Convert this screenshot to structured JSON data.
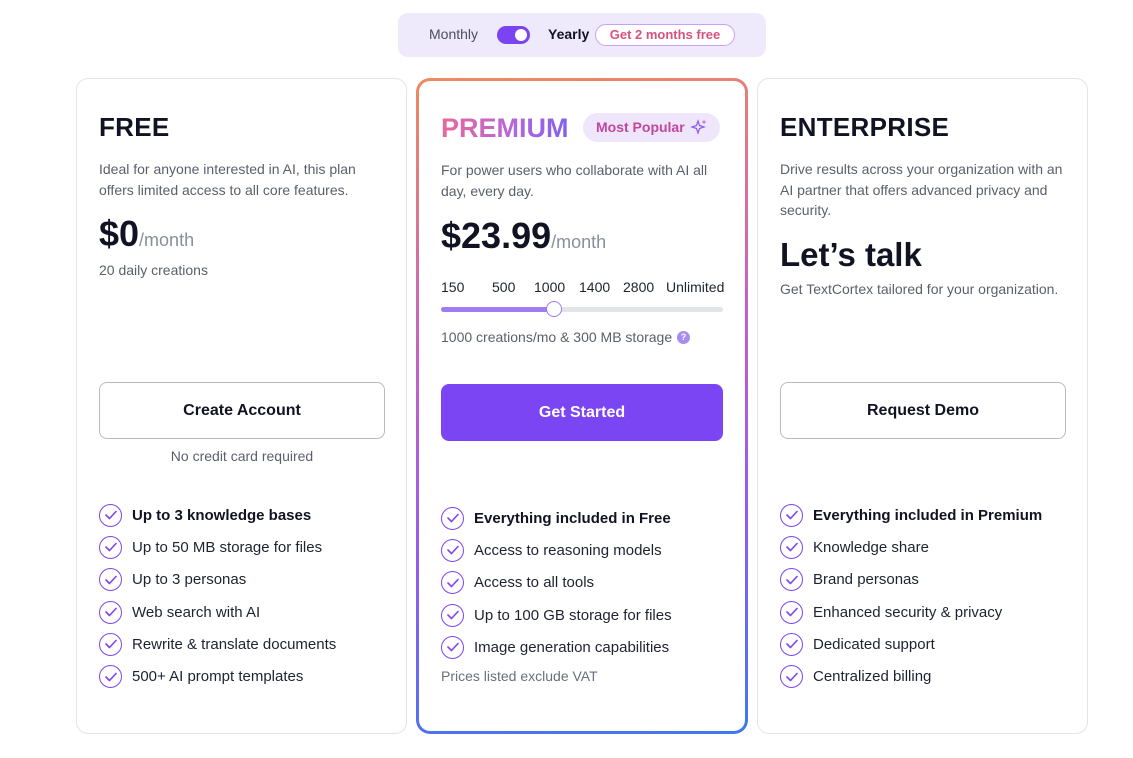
{
  "billing": {
    "monthly_label": "Monthly",
    "yearly_label": "Yearly",
    "promo_label": "Get 2 months free",
    "yearly_selected": true
  },
  "plans": {
    "free": {
      "name": "FREE",
      "description": "Ideal for anyone interested in AI, this plan offers limited access to all core features.",
      "price": "$0",
      "period": "/month",
      "quota": "20 daily creations",
      "cta": "Create Account",
      "cta_note": "No credit card required",
      "features": [
        {
          "text": "Up to 3 knowledge bases",
          "bold": true
        },
        {
          "text": "Up to 50 MB storage for files",
          "bold": false
        },
        {
          "text": "Up to 3 personas",
          "bold": false
        },
        {
          "text": "Web search with AI",
          "bold": false
        },
        {
          "text": "Rewrite & translate documents",
          "bold": false
        },
        {
          "text": "500+ AI prompt templates",
          "bold": false
        }
      ]
    },
    "premium": {
      "name": "PREMIUM",
      "badge": "Most Popular",
      "description": "For power users who collaborate with AI all day, every day.",
      "price": "$23.99",
      "period": "/month",
      "tiers": [
        "150",
        "500",
        "1000",
        "1400",
        "2800",
        "Unlimited"
      ],
      "selected_tier": "1000",
      "slider_fraction": 0.4,
      "storage_note": "1000 creations/mo & 300 MB storage",
      "help_icon": "?",
      "cta": "Get Started",
      "features": [
        {
          "text": "Everything included in Free",
          "bold": true
        },
        {
          "text": "Access to reasoning models",
          "bold": false
        },
        {
          "text": "Access to all tools",
          "bold": false
        },
        {
          "text": "Up to 100 GB storage for files",
          "bold": false
        },
        {
          "text": "Image generation capabilities",
          "bold": false
        }
      ],
      "vat_note": "Prices listed exclude VAT"
    },
    "enterprise": {
      "name": "ENTERPRISE",
      "description": "Drive results across your organization with an AI partner that offers advanced privacy and security.",
      "price_text": "Let’s talk",
      "tagline": "Get TextCortex tailored for your organization.",
      "cta": "Request Demo",
      "features": [
        {
          "text": "Everything included in Premium",
          "bold": true
        },
        {
          "text": "Knowledge share",
          "bold": false
        },
        {
          "text": "Brand personas",
          "bold": false
        },
        {
          "text": "Enhanced security & privacy",
          "bold": false
        },
        {
          "text": "Dedicated support",
          "bold": false
        },
        {
          "text": "Centralized billing",
          "bold": false
        }
      ]
    }
  },
  "colors": {
    "accent": "#7c45f3",
    "check": "#7d45ef",
    "toggle_bg": "#efe9fc",
    "promo_text": "#d7527e"
  },
  "icons": {
    "check": "check-circle-icon",
    "sparkle": "sparkle-icon",
    "help": "help-icon"
  }
}
